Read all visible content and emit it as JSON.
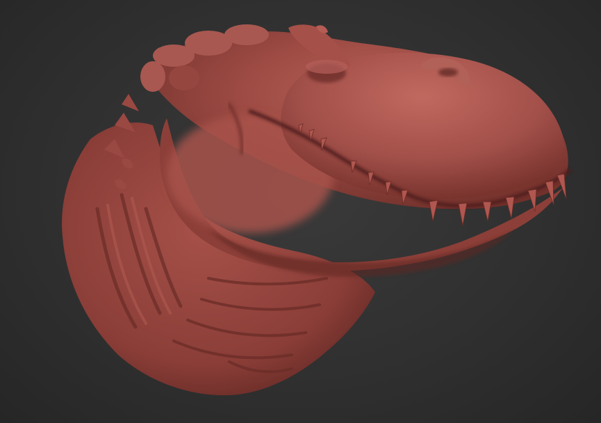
{
  "viewport": {
    "background_color": "#303030"
  },
  "sculpt": {
    "subject": "dinosaur-head",
    "material_color": "#9c4a43",
    "highlight_color": "#b8625a",
    "shadow_color": "#5e2622",
    "teeth_color": "#b0574f"
  }
}
